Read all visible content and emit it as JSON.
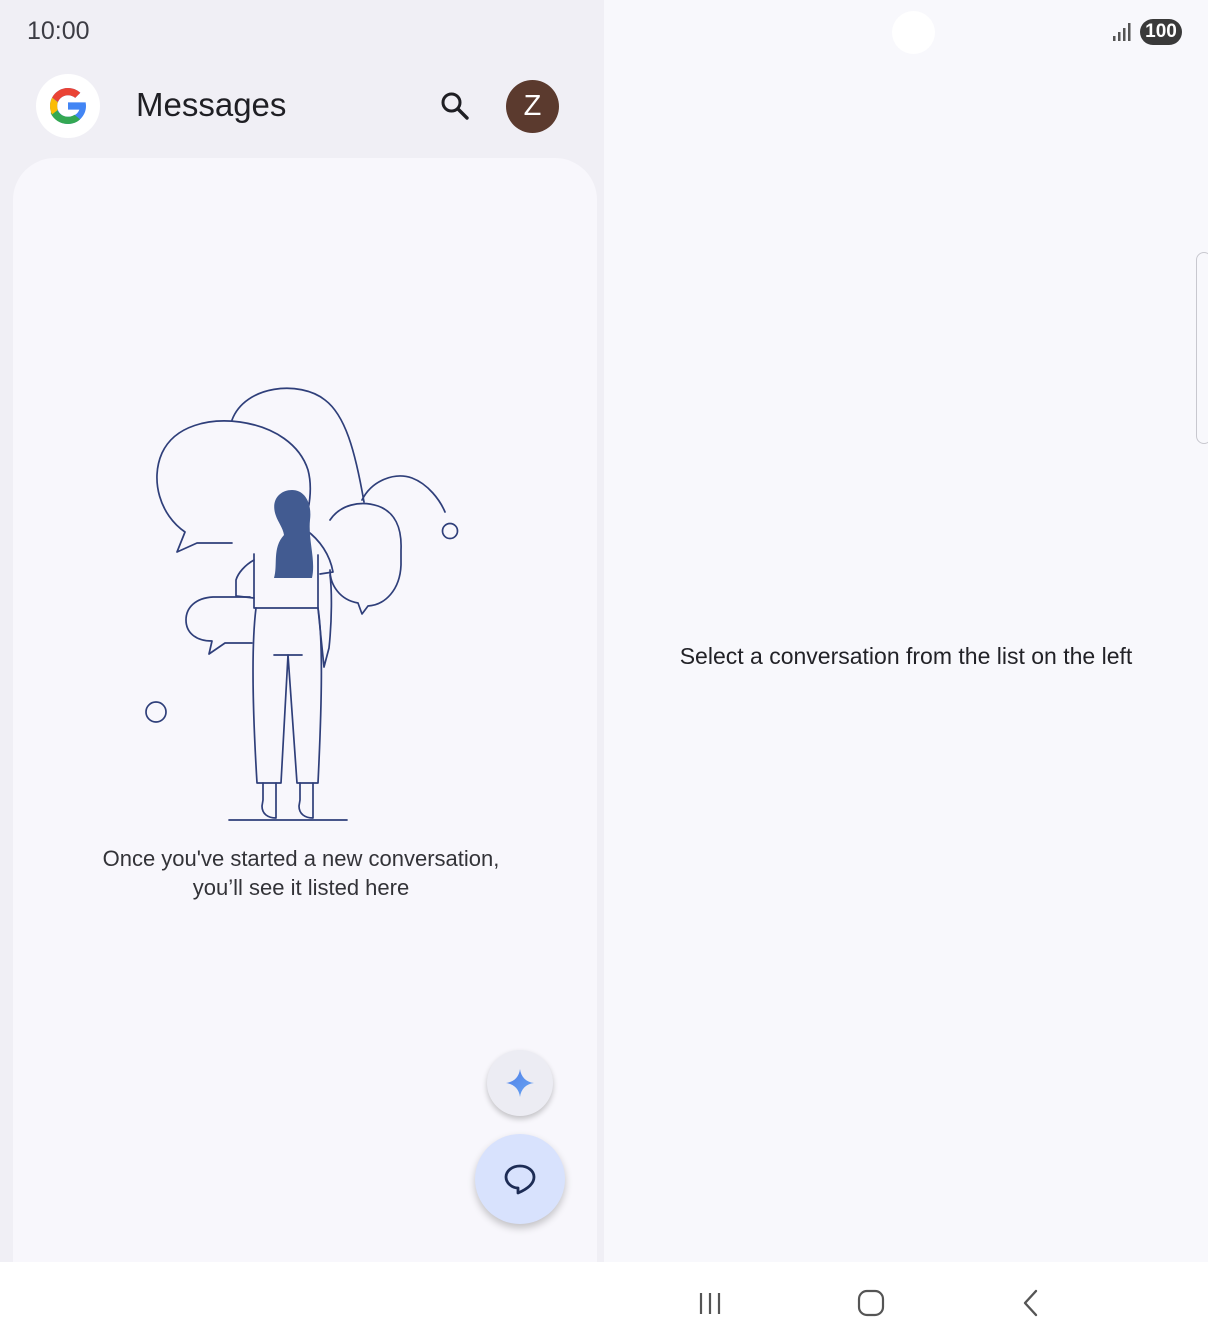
{
  "status_bar": {
    "time": "10:00",
    "battery": "100",
    "signal_icon": "signal-icon"
  },
  "header": {
    "logo_icon": "google-g-icon",
    "title": "Messages",
    "search_icon": "search-icon",
    "avatar_letter": "Z",
    "avatar_color": "#5b3a2e"
  },
  "conversation_list": {
    "empty_message": "Once you've started a new conversation, you’ll see it listed here",
    "illustration": "person-chat-bubbles-illustration"
  },
  "fabs": {
    "ai_icon": "sparkle-icon",
    "compose_icon": "chat-bubble-icon",
    "compose_color": "#d8e2fd"
  },
  "detail_pane": {
    "hint": "Select a conversation from the list on the left"
  },
  "nav_bar": {
    "recents_icon": "recents-icon",
    "home_icon": "home-icon",
    "back_icon": "back-icon"
  },
  "colors": {
    "left_background": "#f0eff5",
    "right_background": "#f8f8fc",
    "illustration_stroke": "#2f3f7a",
    "illustration_fill": "#425b91"
  }
}
